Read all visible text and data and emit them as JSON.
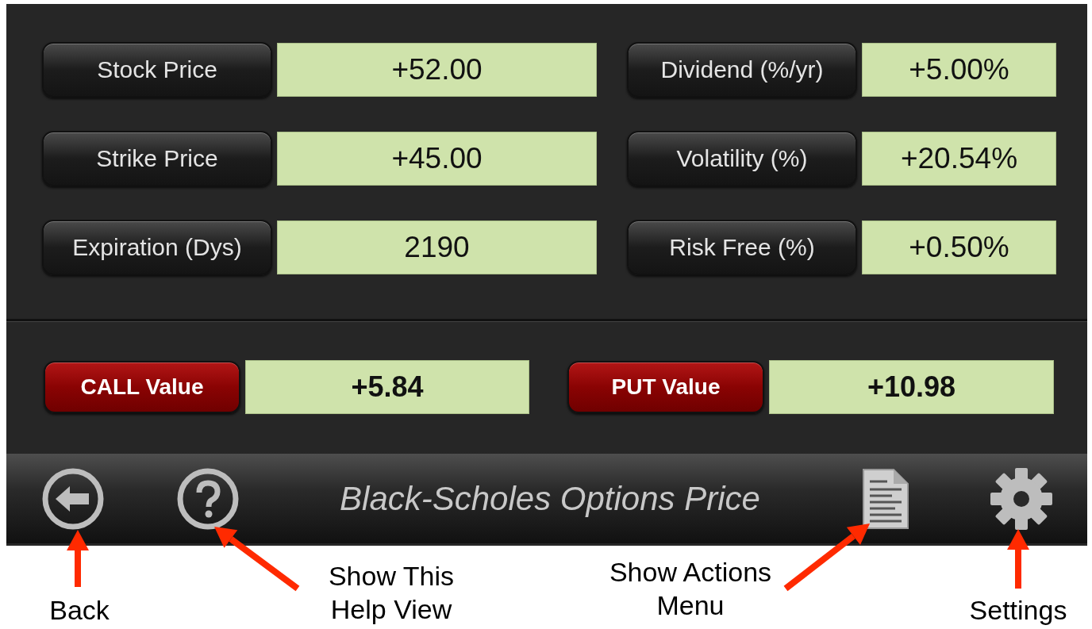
{
  "inputs": [
    {
      "label": "Stock Price",
      "value": "+52.00"
    },
    {
      "label": "Dividend (%/yr)",
      "value": "+5.00%"
    },
    {
      "label": "Strike Price",
      "value": "+45.00"
    },
    {
      "label": "Volatility (%)",
      "value": "+20.54%"
    },
    {
      "label": "Expiration (Dys)",
      "value": "2190"
    },
    {
      "label": "Risk Free (%)",
      "value": "+0.50%"
    }
  ],
  "results": [
    {
      "label": "CALL Value",
      "value": "+5.84"
    },
    {
      "label": "PUT Value",
      "value": "+10.98"
    }
  ],
  "toolbar": {
    "title": "Black-Scholes Options Price",
    "buttons": [
      {
        "kind": "back"
      },
      {
        "kind": "help"
      },
      {
        "kind": "actions"
      },
      {
        "kind": "settings"
      }
    ]
  },
  "annotations": [
    {
      "kind": "back",
      "text": "Back"
    },
    {
      "kind": "help",
      "text": "Show This\nHelp View"
    },
    {
      "kind": "actions",
      "text": "Show Actions\nMenu"
    },
    {
      "kind": "settings",
      "text": "Settings"
    }
  ]
}
